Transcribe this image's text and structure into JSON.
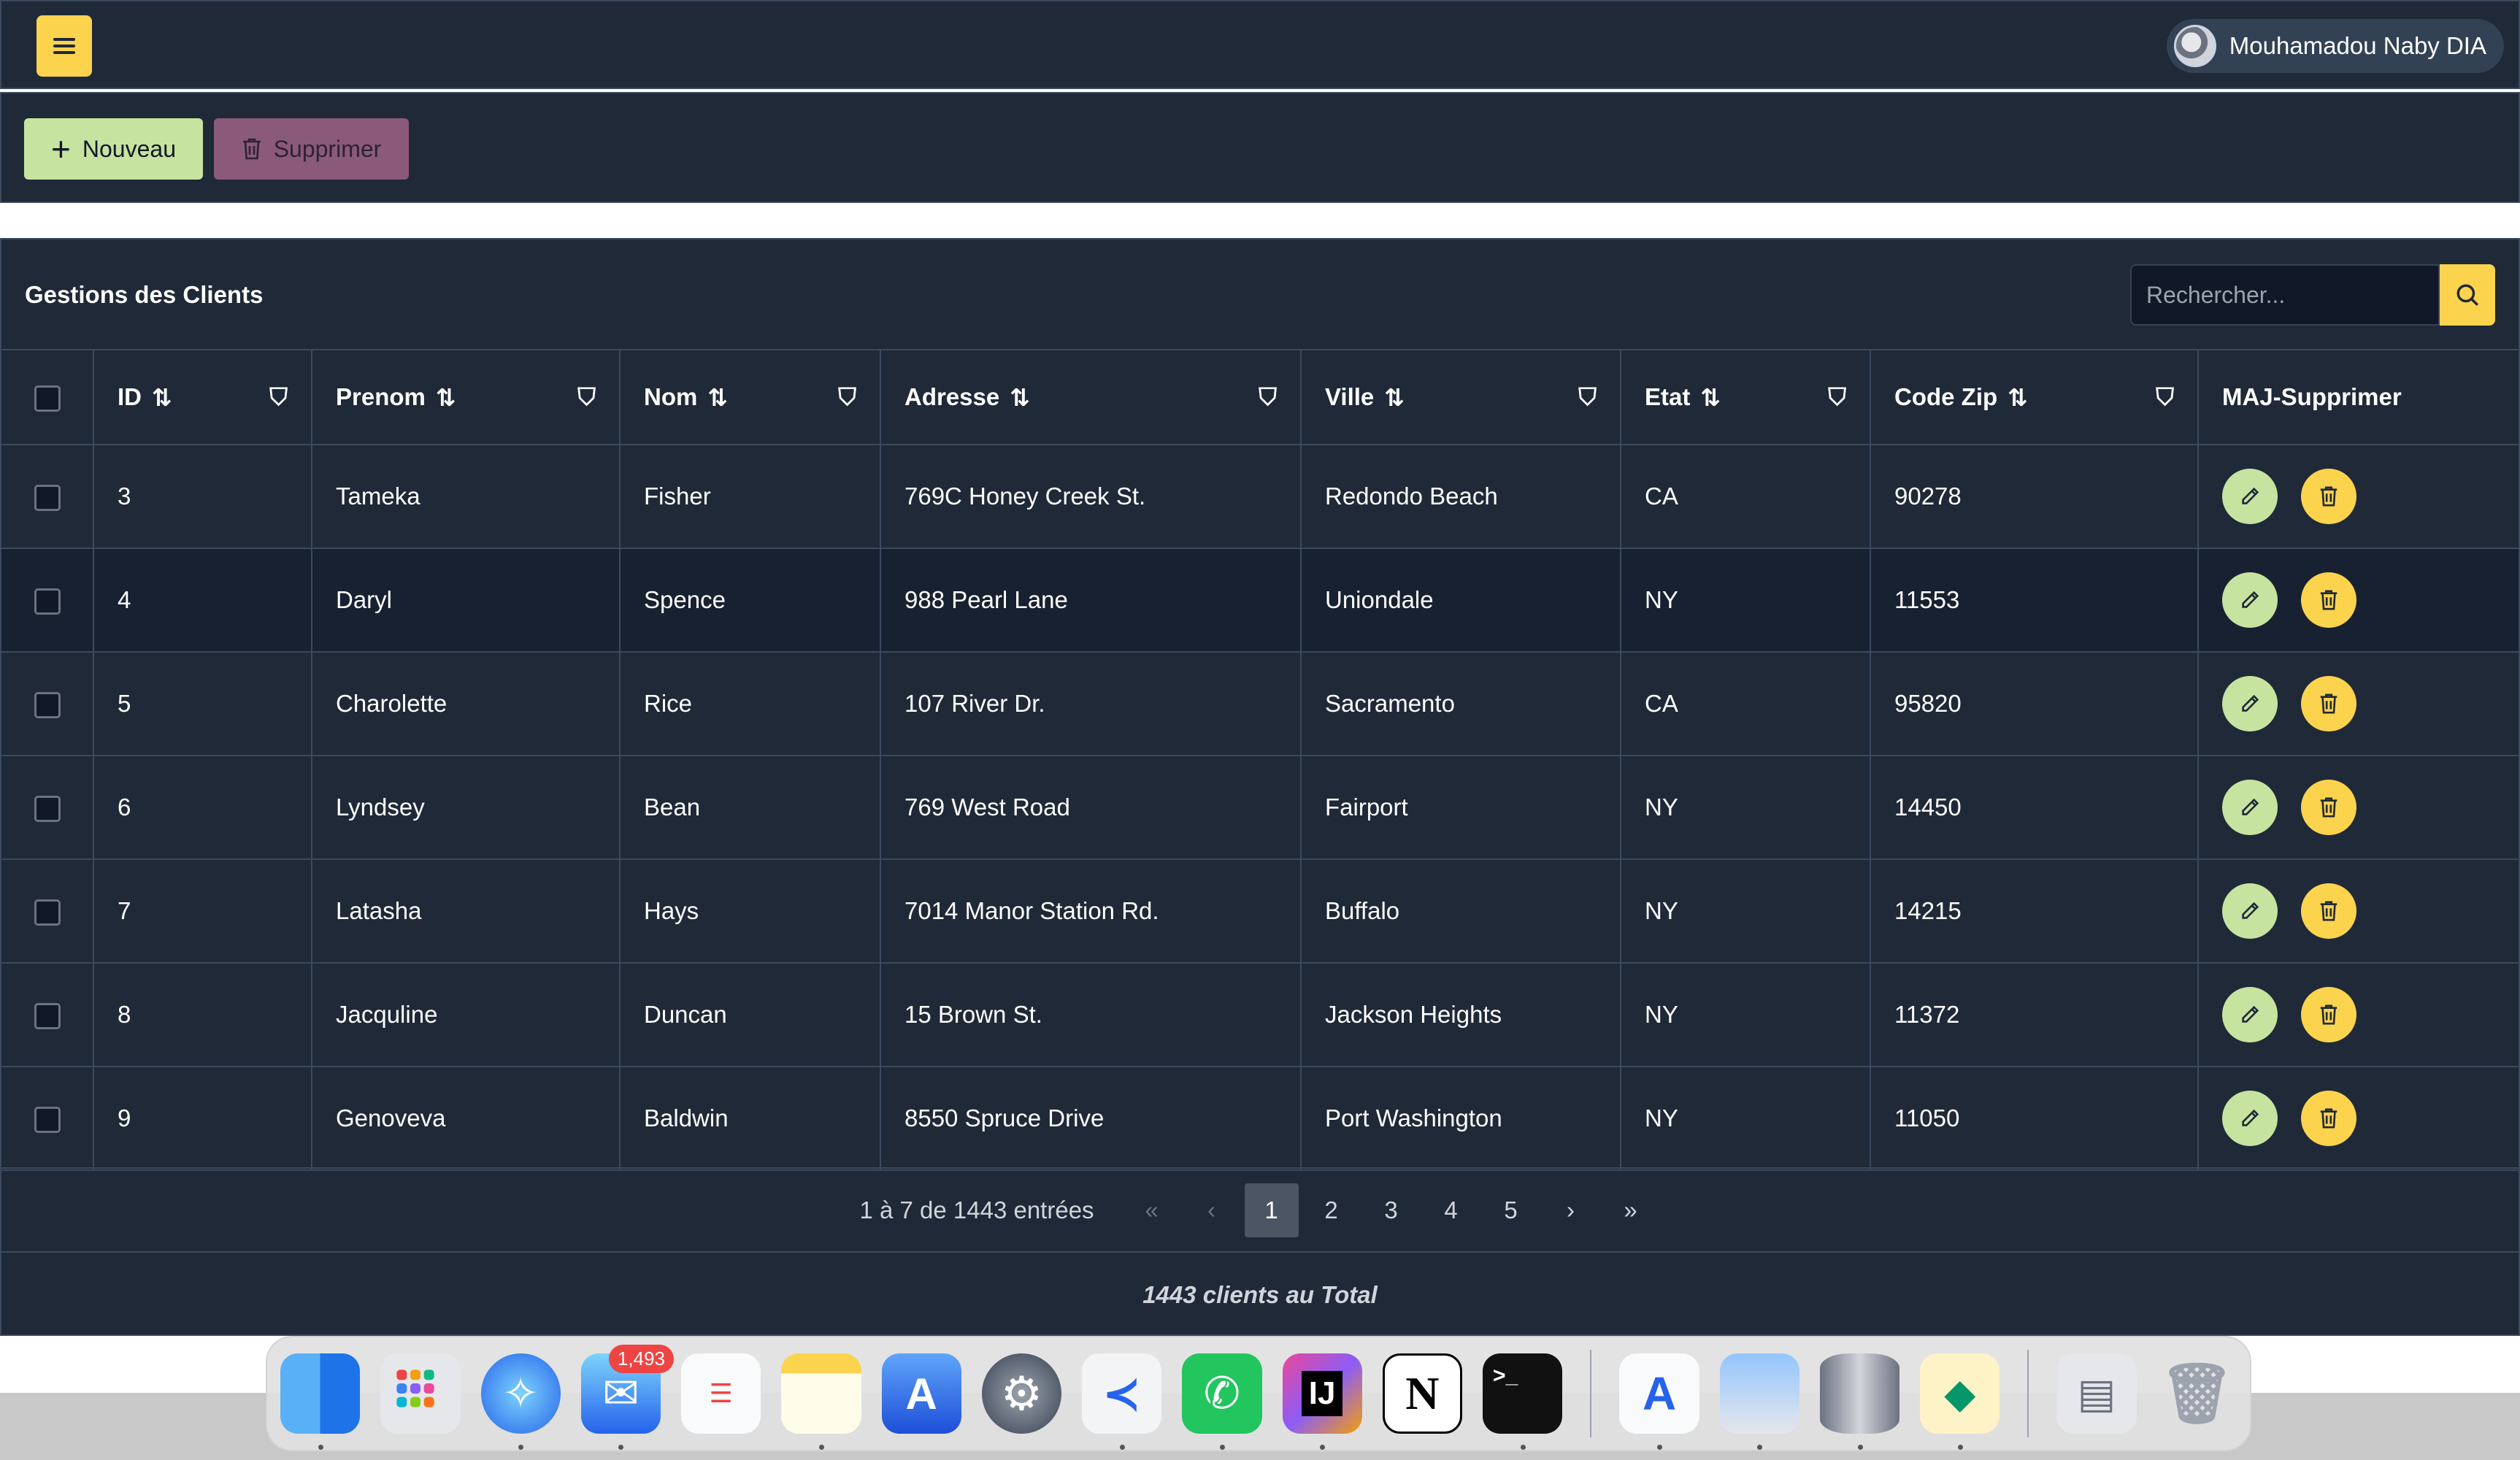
{
  "user": {
    "name": "Mouhamadou Naby DIA"
  },
  "toolbar": {
    "new_label": "Nouveau",
    "delete_label": "Supprimer"
  },
  "panel": {
    "title": "Gestions des Clients",
    "search_placeholder": "Rechercher..."
  },
  "table": {
    "columns": [
      "ID",
      "Prenom",
      "Nom",
      "Adresse",
      "Ville",
      "Etat",
      "Code Zip",
      "MAJ-Supprimer"
    ],
    "rows": [
      {
        "id": "3",
        "prenom": "Tameka",
        "nom": "Fisher",
        "adresse": "769C Honey Creek St.",
        "ville": "Redondo Beach",
        "etat": "CA",
        "zip": "90278"
      },
      {
        "id": "4",
        "prenom": "Daryl",
        "nom": "Spence",
        "adresse": "988 Pearl Lane",
        "ville": "Uniondale",
        "etat": "NY",
        "zip": "11553"
      },
      {
        "id": "5",
        "prenom": "Charolette",
        "nom": "Rice",
        "adresse": "107 River Dr.",
        "ville": "Sacramento",
        "etat": "CA",
        "zip": "95820"
      },
      {
        "id": "6",
        "prenom": "Lyndsey",
        "nom": "Bean",
        "adresse": "769 West Road",
        "ville": "Fairport",
        "etat": "NY",
        "zip": "14450"
      },
      {
        "id": "7",
        "prenom": "Latasha",
        "nom": "Hays",
        "adresse": "7014 Manor Station Rd.",
        "ville": "Buffalo",
        "etat": "NY",
        "zip": "14215"
      },
      {
        "id": "8",
        "prenom": "Jacquline",
        "nom": "Duncan",
        "adresse": "15 Brown St.",
        "ville": "Jackson Heights",
        "etat": "NY",
        "zip": "11372"
      },
      {
        "id": "9",
        "prenom": "Genoveva",
        "nom": "Baldwin",
        "adresse": "8550 Spruce Drive",
        "ville": "Port Washington",
        "etat": "NY",
        "zip": "11050"
      }
    ]
  },
  "pagination": {
    "info": "1 à 7 de 1443 entrées",
    "first": "«",
    "prev": "‹",
    "pages": [
      "1",
      "2",
      "3",
      "4",
      "5"
    ],
    "current": "1",
    "next": "›",
    "last": "»"
  },
  "footer": {
    "total": "1443 clients au Total"
  },
  "dock": {
    "mail_badge": "1,493",
    "intellij_label": "IJ",
    "notion_label": "N",
    "terminal_label": ">_"
  },
  "colors": {
    "panel_bg": "#1f2937",
    "accent_yellow": "#fcd34d",
    "accent_green": "#c7e3a0",
    "delete_btn": "#8b5a7a"
  }
}
